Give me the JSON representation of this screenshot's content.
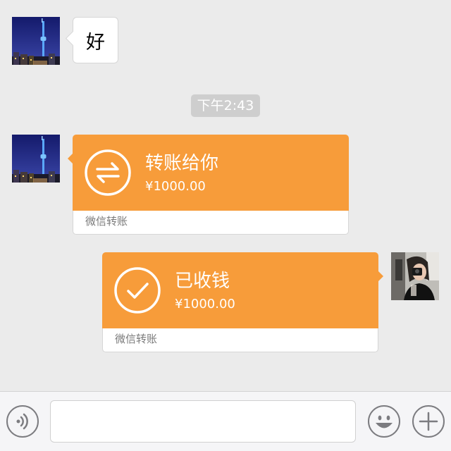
{
  "messages": [
    {
      "sender": "other",
      "type": "text",
      "text": "好"
    },
    {
      "type": "timestamp",
      "text": "下午2:43"
    },
    {
      "sender": "other",
      "type": "transfer",
      "title": "转账给你",
      "amount": "¥1000.00",
      "footer": "微信转账"
    },
    {
      "sender": "self",
      "type": "transfer",
      "title": "已收钱",
      "amount": "¥1000.00",
      "footer": "微信转账"
    }
  ],
  "colors": {
    "background": "#ebebeb",
    "transfer_orange": "#f79c3a",
    "timestamp_badge": "#cecece",
    "input_bar": "#f5f5f7"
  },
  "icons": {
    "transfer": "transfer-arrows-icon",
    "received": "checkmark-icon",
    "voice": "voice-icon",
    "emoji": "emoji-icon",
    "more": "plus-icon"
  },
  "input": {
    "value": "",
    "placeholder": ""
  }
}
